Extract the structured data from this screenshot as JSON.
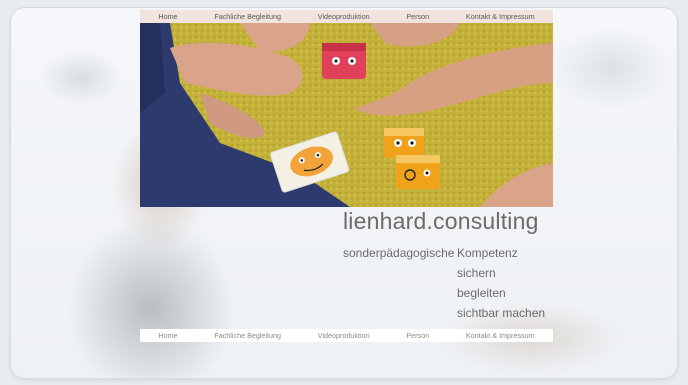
{
  "nav": {
    "items": [
      "Home",
      "Fachliche Begleitung",
      "Videoproduktion",
      "Person",
      "Kontakt & Impressum"
    ]
  },
  "hero": {
    "image_alt": "Hands playing a board game with face cubes and cards"
  },
  "brand": {
    "title": "lienhard.consulting",
    "subtitle": "sonderpädagogische",
    "lines": [
      "Kompetenz",
      "sichern",
      "begleiten",
      "sichtbar machen"
    ]
  },
  "colors": {
    "nav_top_bg": "#f1e3de",
    "carpet": "#c4b23a",
    "cube_orange": "#f0a21a",
    "cube_red": "#e0405a",
    "text_gray": "#6b6b6b"
  }
}
